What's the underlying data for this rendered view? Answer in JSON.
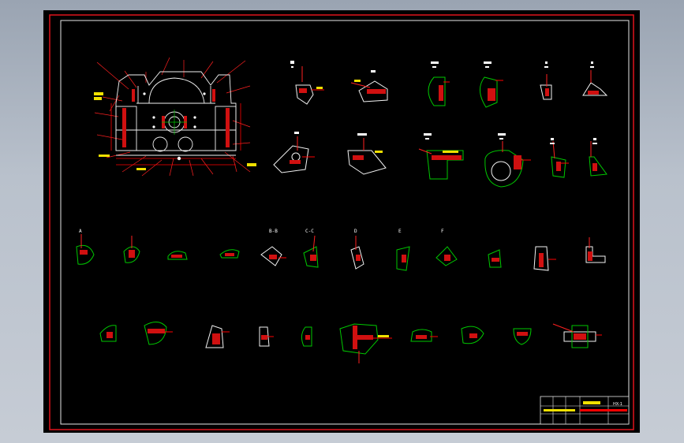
{
  "colors": {
    "background": "#000000",
    "frame": "#e0141c",
    "inner_frame": "#e8e8e8",
    "outline": "#f2f2f2",
    "dimension": "#ff0000",
    "section": "#00c800",
    "hatch": "#d01010",
    "leader": "#ff2020",
    "text": "#ffffff"
  },
  "row2_views": [
    {
      "label": "A"
    },
    {
      "label": "B-B"
    },
    {
      "label": "C-C"
    },
    {
      "label": "D"
    },
    {
      "label": "E"
    },
    {
      "label": "F"
    }
  ],
  "title_block": {
    "part_no": "HX-1"
  }
}
